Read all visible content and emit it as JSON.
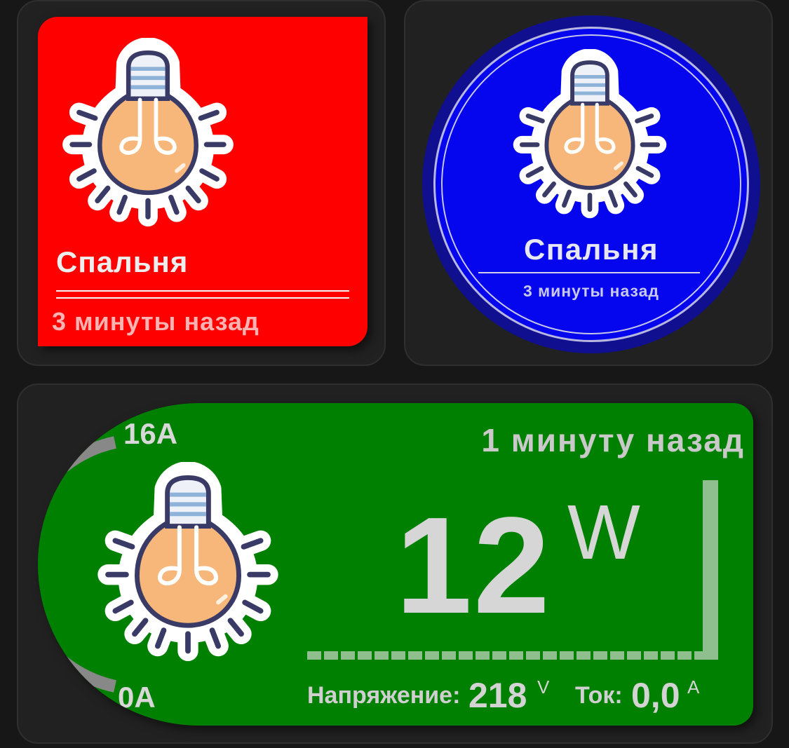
{
  "bedroom_light_square": {
    "name": "Спальня",
    "last_changed": "3 минуты назад",
    "background": "#ff0000",
    "icon": "light-bulb-icon"
  },
  "bedroom_light_round": {
    "name": "Спальня",
    "last_changed": "3 минуты назад",
    "background": "#0505ee",
    "icon": "light-bulb-icon"
  },
  "power_card": {
    "last_changed": "1 минуту назад",
    "power_value": "12",
    "power_unit": "W",
    "current_max_label": "16A",
    "current_min_label": "0A",
    "voltage_label": "Напряжение:",
    "voltage_value": "218",
    "voltage_unit": "V",
    "current_label": "Ток:",
    "current_value": "0,0",
    "current_unit": "A",
    "background": "#008000",
    "icon": "light-bulb-icon"
  }
}
